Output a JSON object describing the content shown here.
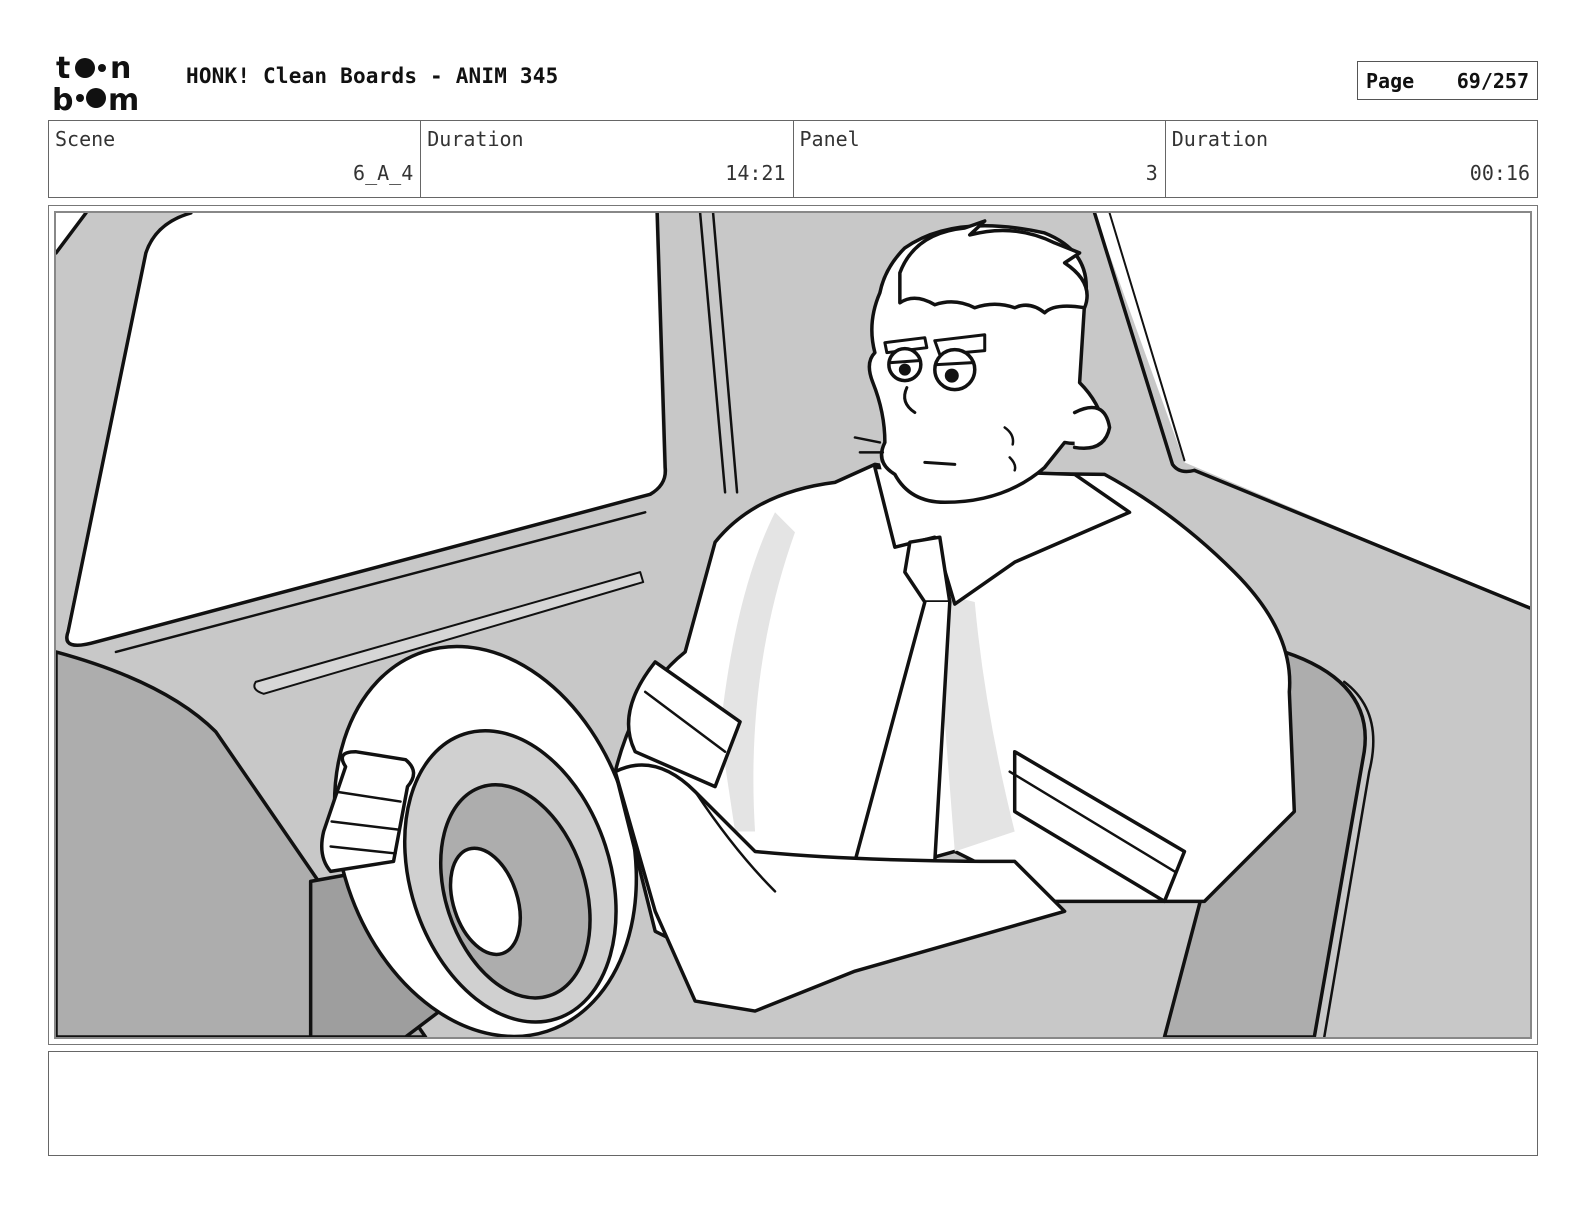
{
  "header": {
    "logo_name": "toon-boom-logo",
    "doc_title": "HONK! Clean Boards - ANIM 345",
    "page_label": "Page",
    "page_value": "69/257"
  },
  "info": {
    "scene_label": "Scene",
    "scene_value": "6_A_4",
    "scene_duration_label": "Duration",
    "scene_duration_value": "14:21",
    "panel_label": "Panel",
    "panel_value": "3",
    "panel_duration_label": "Duration",
    "panel_duration_value": "00:16"
  },
  "panel_image": {
    "subject": "driver-at-steering-wheel-sketch"
  },
  "notes": {
    "text": ""
  },
  "colors": {
    "border": "#666666",
    "sketch_line": "#111111",
    "tone_light": "#c8c8c8",
    "tone_mid": "#adadad",
    "tone_shadow": "#e4e4e4"
  }
}
